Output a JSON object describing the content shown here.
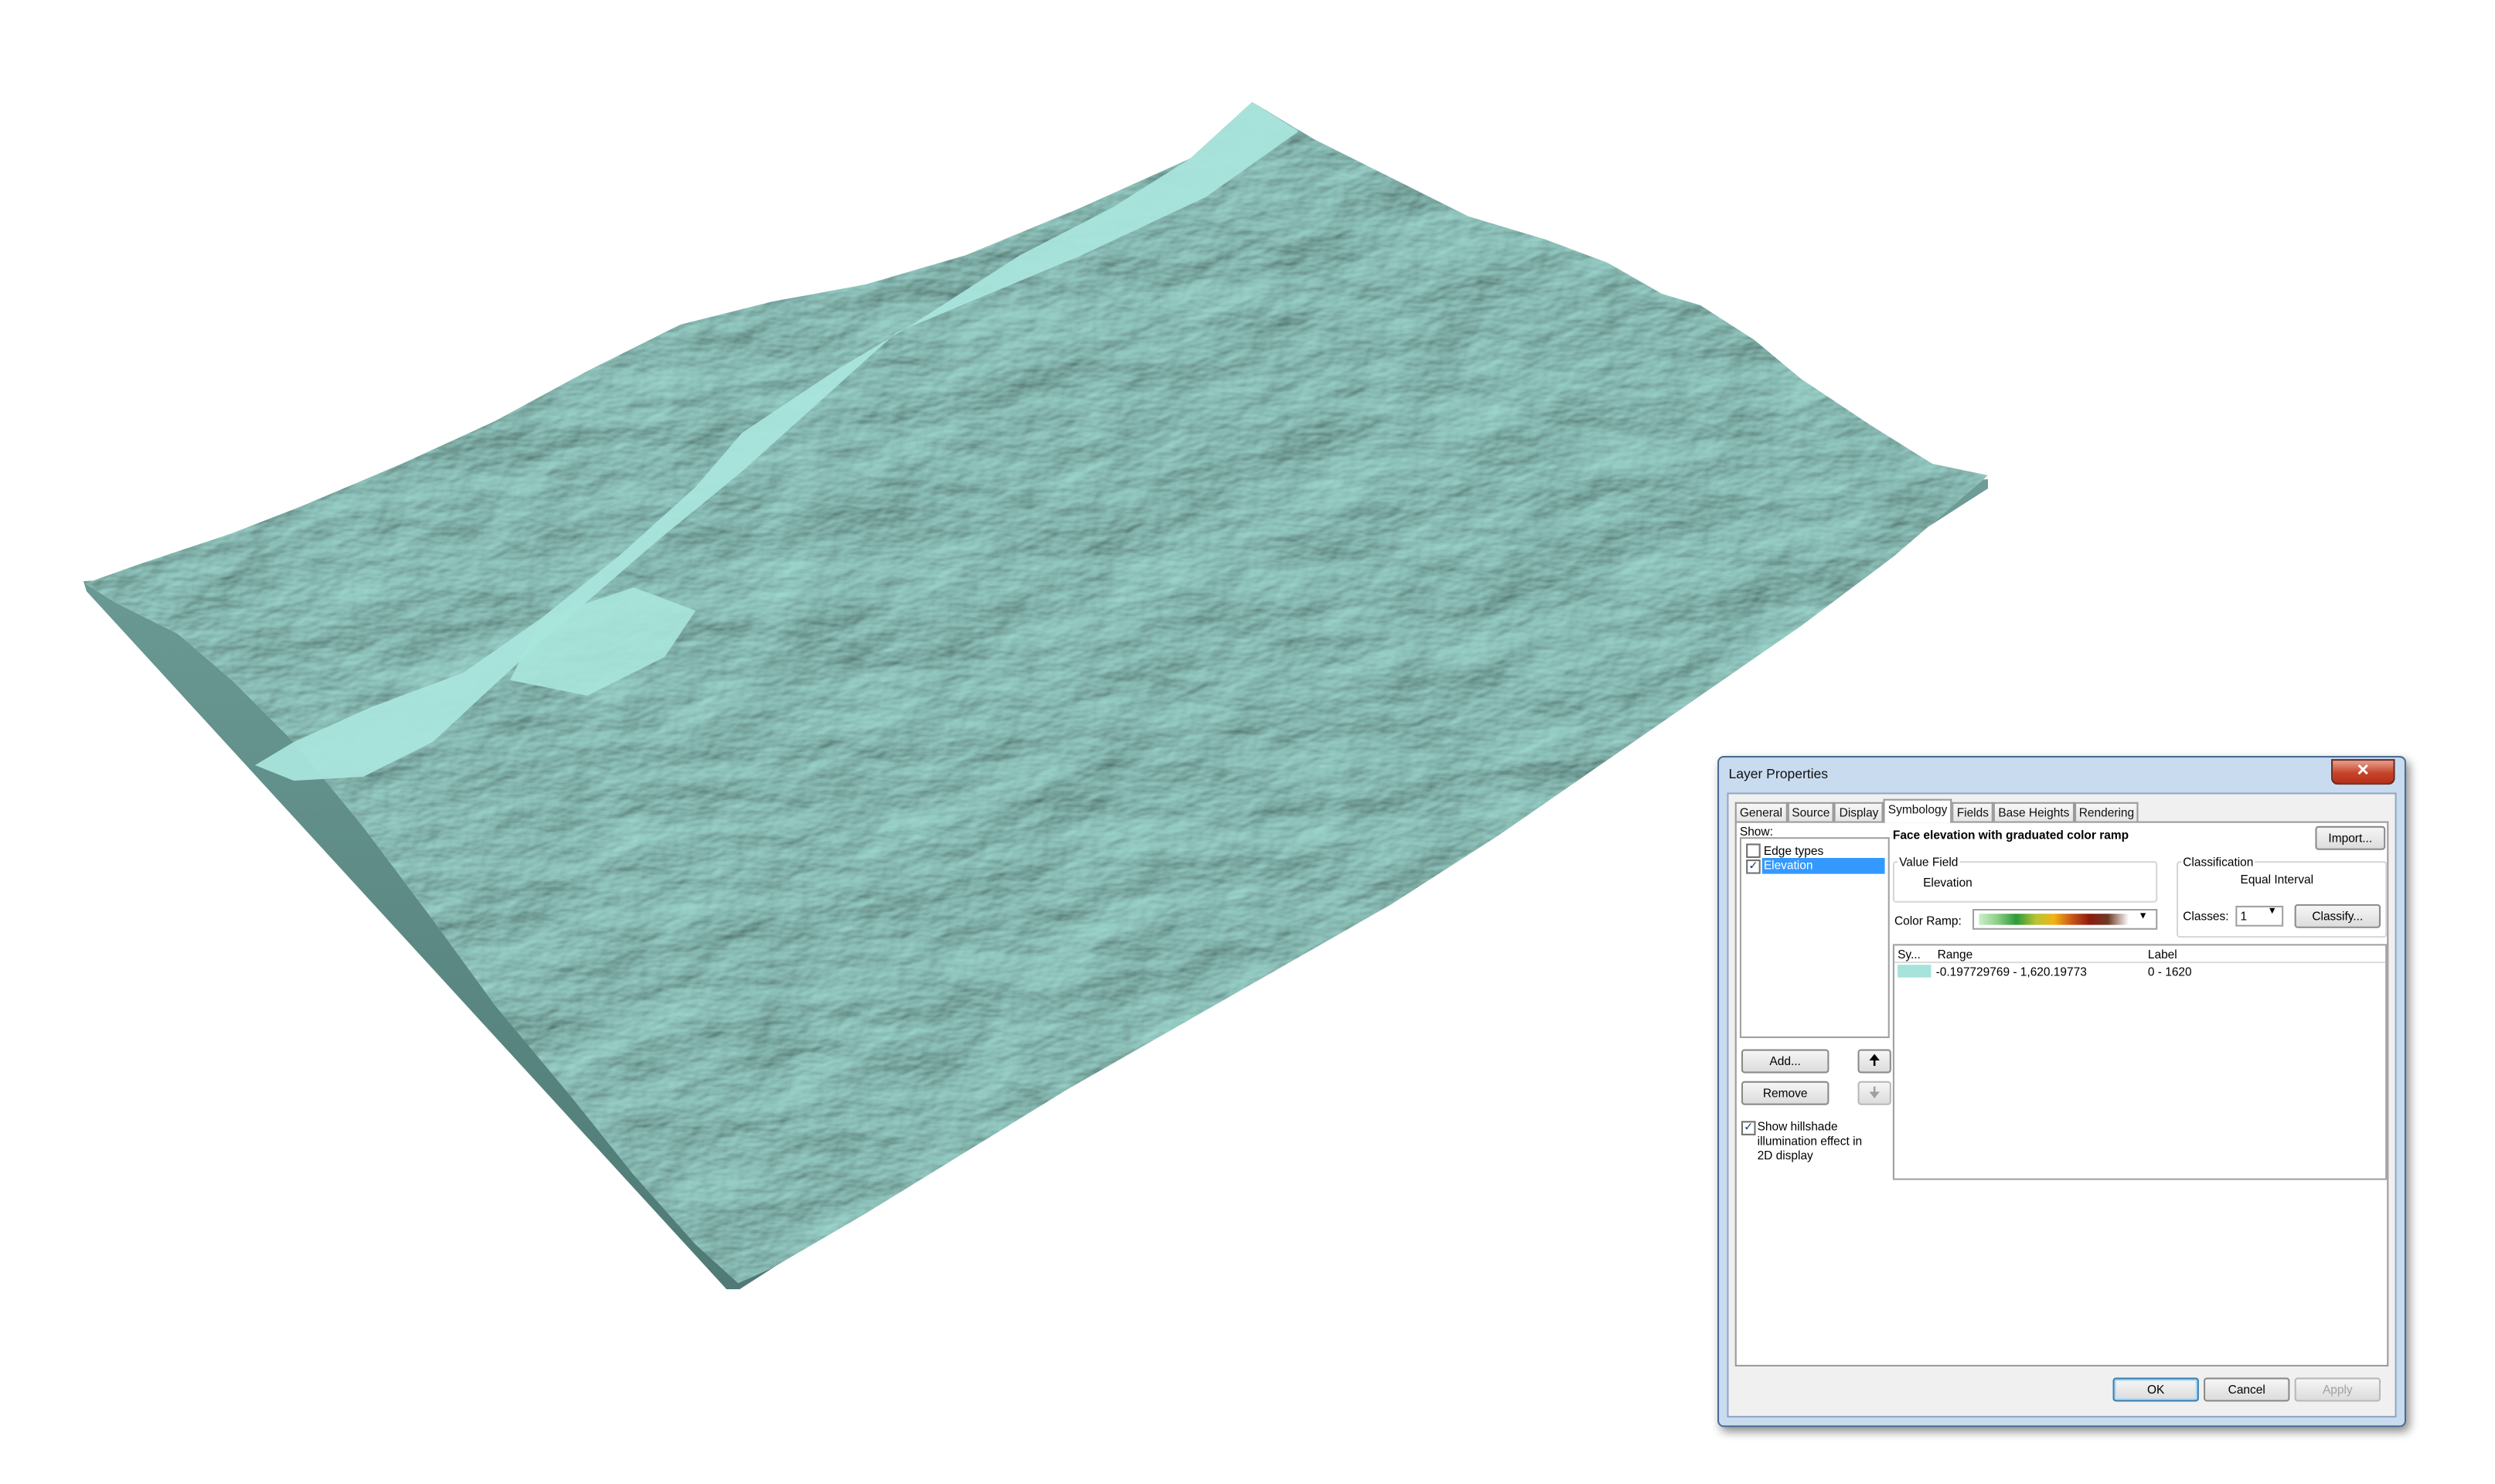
{
  "dialog": {
    "title": "Layer Properties",
    "close_glyph": "✕",
    "tabs": [
      "General",
      "Source",
      "Display",
      "Symbology",
      "Fields",
      "Base Heights",
      "Rendering"
    ],
    "active_tab": "Symbology",
    "show_label": "Show:",
    "show_items": [
      {
        "label": "Edge types",
        "checked": false,
        "selected": false
      },
      {
        "label": "Elevation",
        "checked": true,
        "selected": true
      }
    ],
    "add_button": "Add...",
    "remove_button": "Remove",
    "hillshade_label_line1": "Show hillshade",
    "hillshade_label_line2": "illumination effect in",
    "hillshade_label_line3": "2D display",
    "hillshade_checked": true,
    "heading": "Face elevation with graduated color ramp",
    "import_button": "Import...",
    "value_field_label": "Value Field",
    "value_field_value": "Elevation",
    "classification_label": "Classification",
    "classification_value": "Equal Interval",
    "color_ramp_label": "Color Ramp:",
    "classes_label": "Classes:",
    "classes_value": "1",
    "classify_button": "Classify...",
    "table_headers": [
      "Sy...",
      "Range",
      "Label"
    ],
    "table_rows": [
      {
        "swatch": "#a6e3da",
        "range": "-0.197729769 - 1,620.19773",
        "label": "0 - 1620"
      }
    ],
    "ok_button": "OK",
    "cancel_button": "Cancel",
    "apply_button": "Apply"
  },
  "colors": {
    "terrain": "#a6e3da",
    "terrain_shadow": "#5d8c86",
    "dialog_frame": "#c9dcef",
    "selection": "#3399ff"
  }
}
